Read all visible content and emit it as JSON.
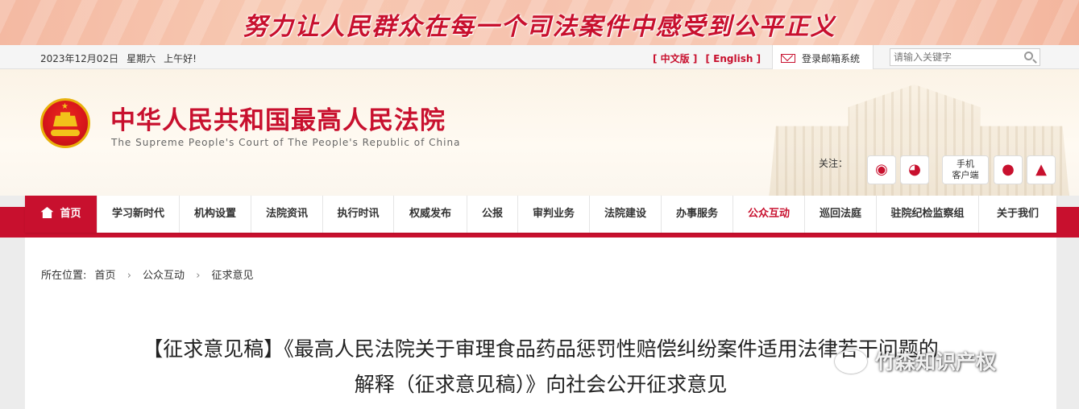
{
  "banner": {
    "slogan": "努力让人民群众在每一个司法案件中感受到公平正义"
  },
  "topbar": {
    "date": "2023年12月02日",
    "weekday": "星期六",
    "greeting": "上午好!",
    "lang_cn": "[ 中文版 ]",
    "lang_en": "[ English ]",
    "mailbox": "登录邮箱系统",
    "search_placeholder": "请输入关键字"
  },
  "header": {
    "title": "中华人民共和国最高人民法院",
    "subtitle": "The Supreme People's Court of The People's Republic of China",
    "follow_label": "关注：",
    "mobile_client_line1": "手机",
    "mobile_client_line2": "客户端",
    "icons": [
      "weibo-icon",
      "wechat-icon",
      "apple-icon",
      "android-icon"
    ]
  },
  "nav": {
    "items": [
      "首页",
      "学习新时代",
      "机构设置",
      "法院资讯",
      "执行时讯",
      "权威发布",
      "公报",
      "审判业务",
      "法院建设",
      "办事服务",
      "公众互动",
      "巡回法庭",
      "驻院纪检监察组",
      "关于我们"
    ],
    "active_index": 10
  },
  "breadcrumb": {
    "label": "所在位置:",
    "items": [
      "首页",
      "公众互动",
      "征求意见"
    ]
  },
  "article": {
    "title_line1": "【征求意见稿】《最高人民法院关于审理食品药品惩罚性赔偿纠纷案件适用法律若干问题的",
    "title_line2": "解释（征求意见稿）》向社会公开征求意见"
  },
  "watermark": {
    "text": "竹森知识产权"
  },
  "colors": {
    "brand_red": "#c8102e",
    "gold": "#f2c21a",
    "header_bg": "#fbf3e6"
  }
}
